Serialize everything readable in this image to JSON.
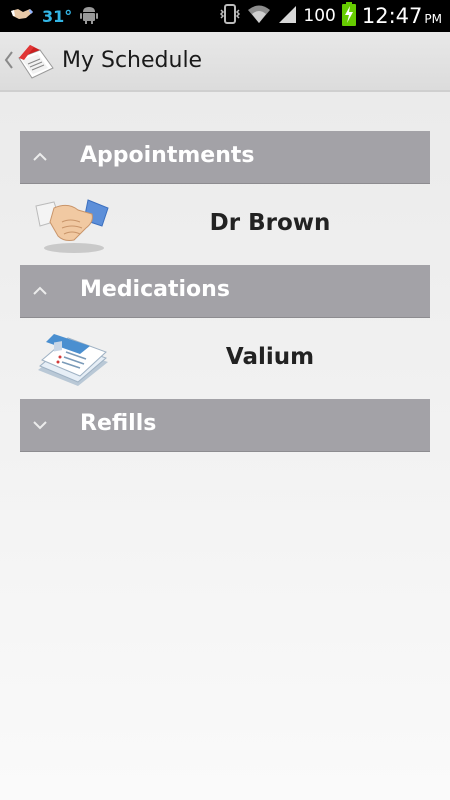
{
  "status_bar": {
    "temperature": "31°",
    "battery": "100",
    "time": "12:47",
    "ampm": "PM"
  },
  "action_bar": {
    "title": "My Schedule"
  },
  "sections": [
    {
      "label": "Appointments",
      "expanded": true,
      "items": [
        {
          "label": "Dr Brown",
          "icon": "handshake-icon"
        }
      ]
    },
    {
      "label": "Medications",
      "expanded": true,
      "items": [
        {
          "label": "Valium",
          "icon": "prescription-pad-icon"
        }
      ]
    },
    {
      "label": "Refills",
      "expanded": false,
      "items": []
    }
  ],
  "colors": {
    "section_header": "#a3a2a7",
    "status_accent": "#33b5e5",
    "battery_green": "#66cc00"
  }
}
